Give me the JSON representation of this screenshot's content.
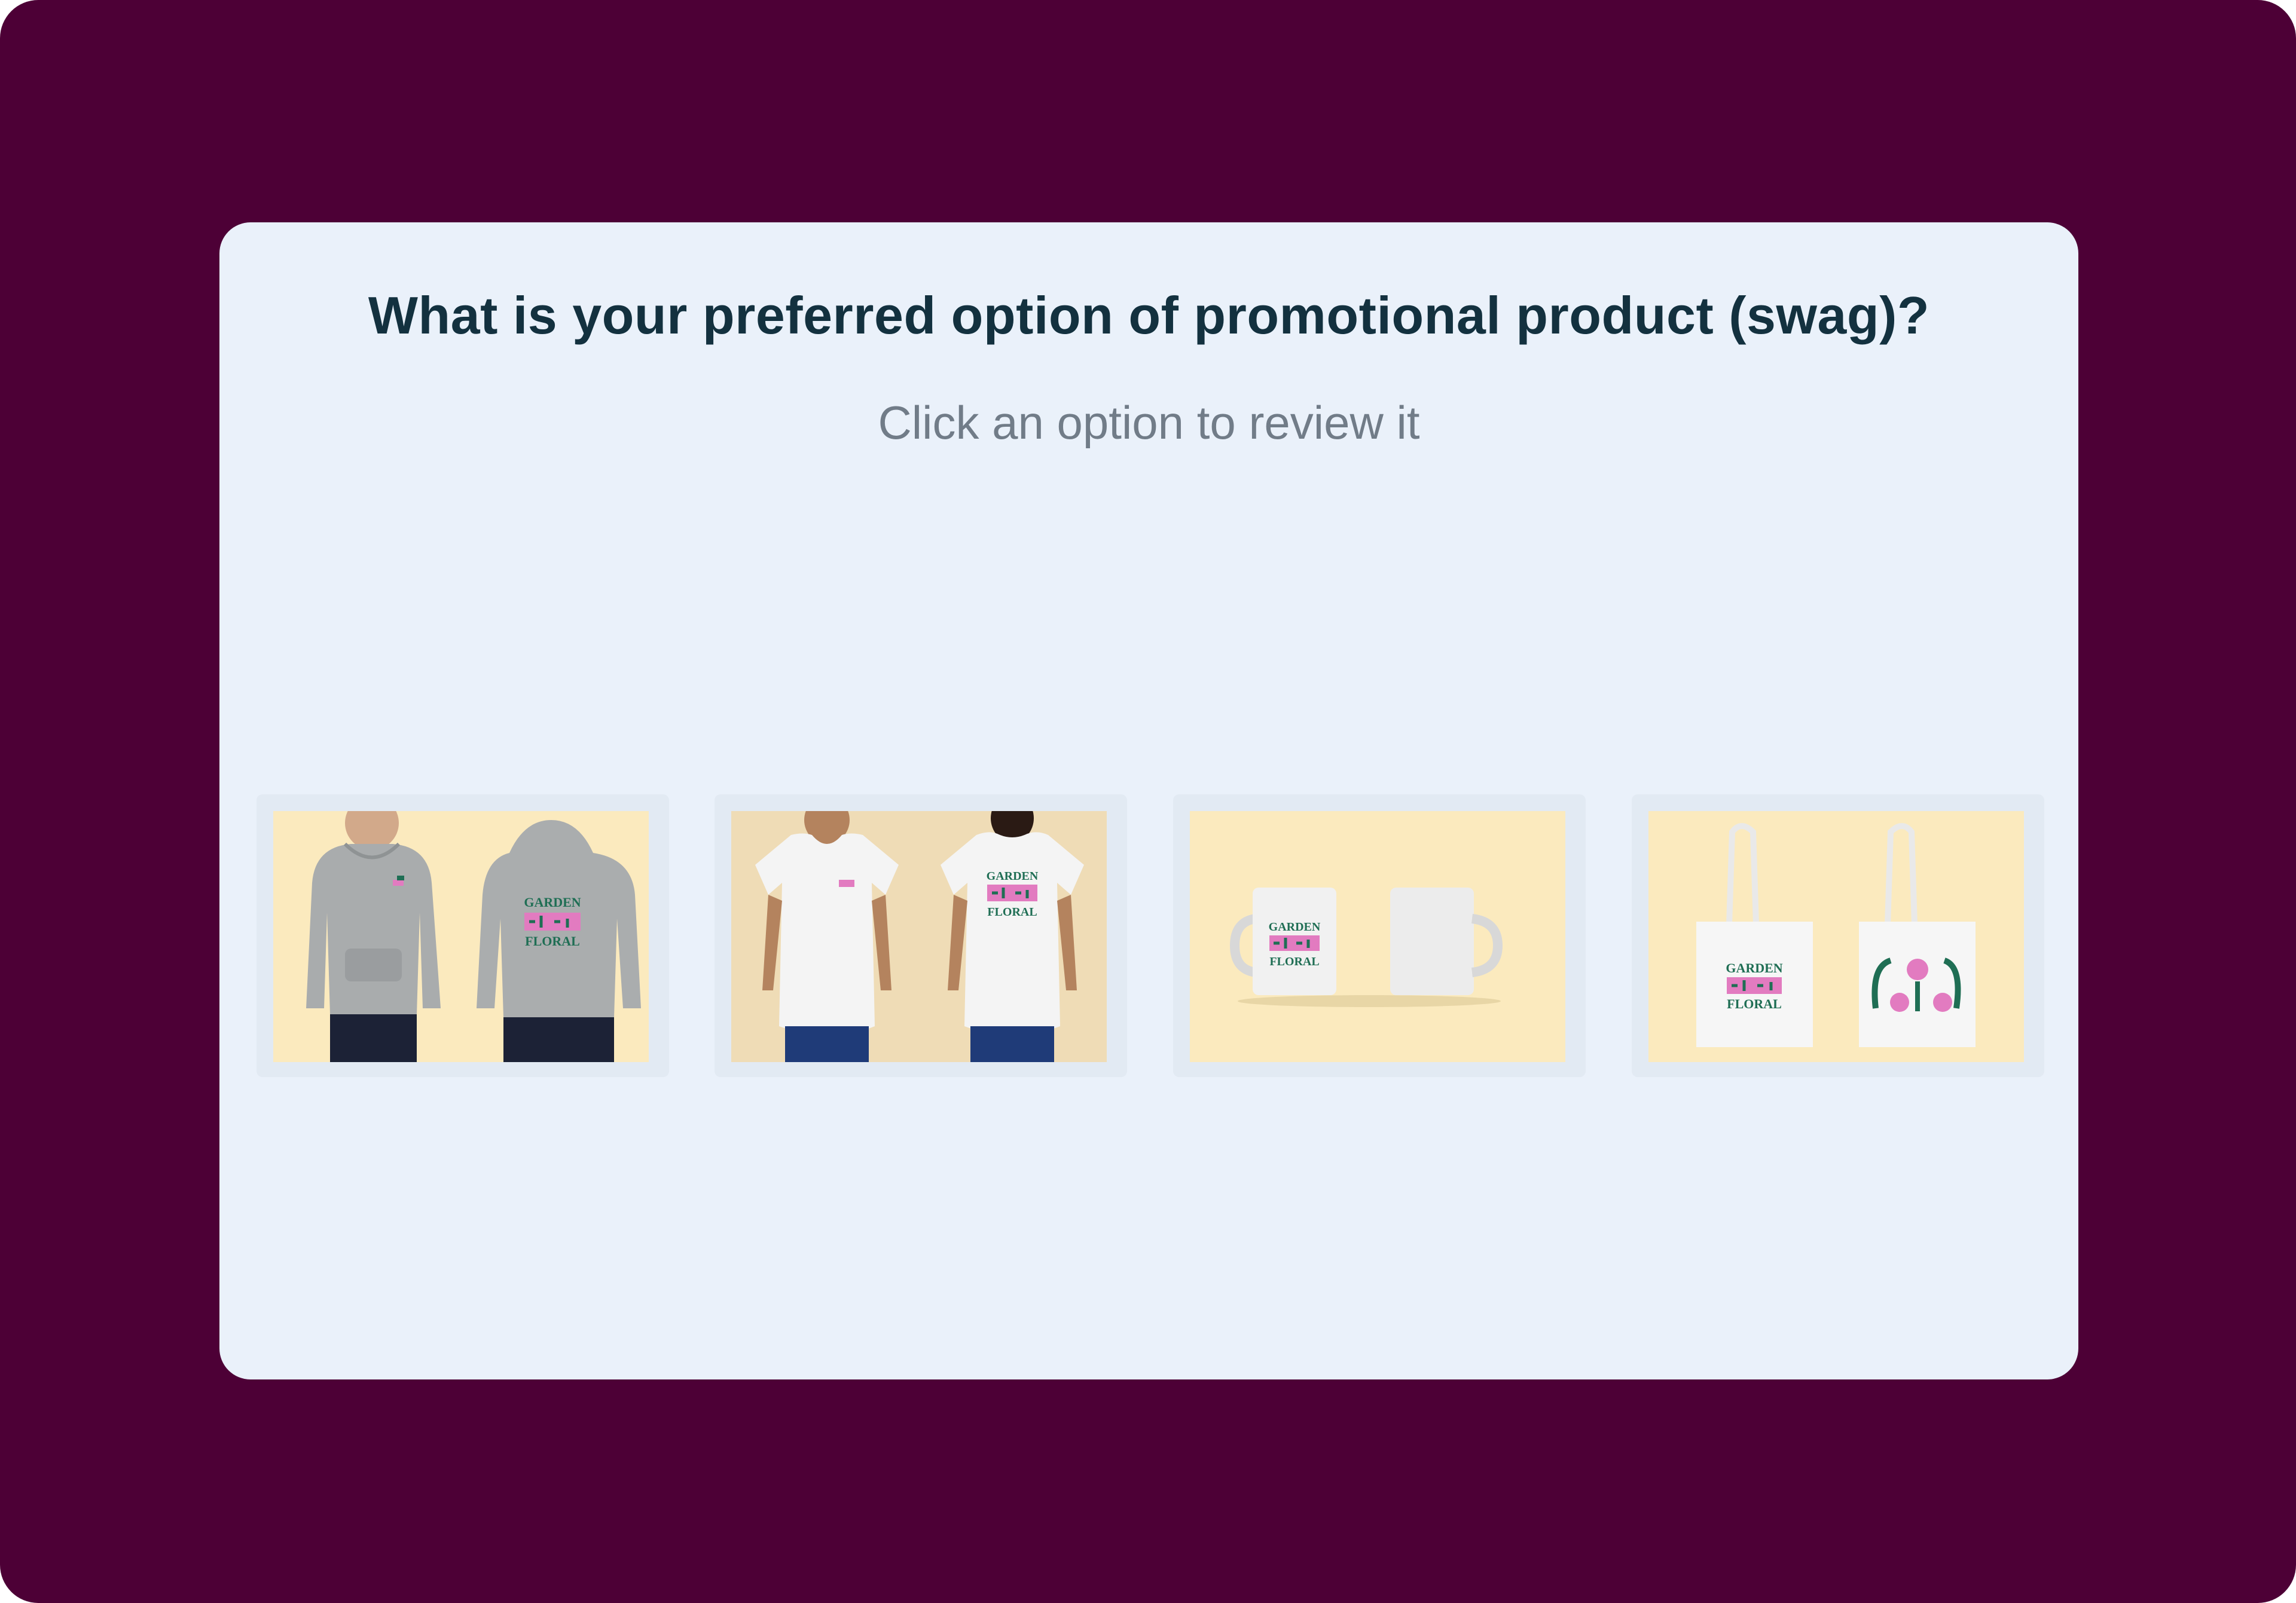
{
  "survey": {
    "question": "What is your preferred option of promotional product (swag)?",
    "instruction": "Click an option to review it"
  },
  "options": [
    {
      "icon": "hoodie-image",
      "logo_lines": [
        "GARDEN",
        "FLORAL"
      ]
    },
    {
      "icon": "tshirt-image",
      "logo_lines": [
        "GARDEN",
        "FLORAL"
      ]
    },
    {
      "icon": "mug-image",
      "logo_lines": [
        "GARDEN",
        "FLORAL"
      ]
    },
    {
      "icon": "tote-bag-image",
      "logo_lines": [
        "GARDEN",
        "FLORAL"
      ]
    }
  ],
  "colors": {
    "frame": "#4d0036",
    "card": "#eaf1fa",
    "title": "#13313f",
    "subtitle": "#717c88",
    "image_bg": "#fbeabe",
    "logo_green": "#1f6e54",
    "logo_pink": "#e27bc0"
  }
}
